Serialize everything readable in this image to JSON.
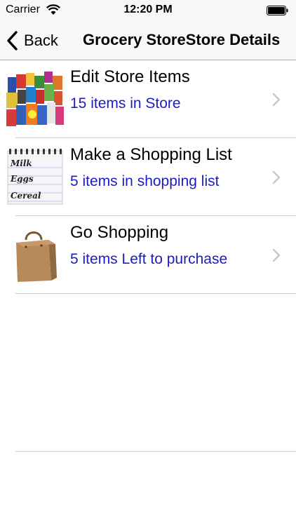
{
  "status_bar": {
    "carrier": "Carrier",
    "time": "12:20 PM",
    "wifi_icon": "wifi-icon",
    "battery_icon": "battery-icon"
  },
  "nav": {
    "back_label": "Back",
    "title": "Grocery StoreStore Details"
  },
  "rows": [
    {
      "title": "Edit Store Items",
      "subtitle": "15 items in Store",
      "icon": "grocery-products-icon"
    },
    {
      "title": "Make a Shopping List",
      "subtitle": "5 items in shopping list",
      "icon": "notepad-icon"
    },
    {
      "title": "Go Shopping",
      "subtitle": "5 items Left to purchase",
      "icon": "shopping-bag-icon"
    }
  ],
  "notepad_text": [
    "Milk",
    "Eggs",
    "Cereal"
  ],
  "colors": {
    "subtitle": "#1c1cc4",
    "nav_background": "#f7f7f7",
    "separator": "#d0d0d0"
  }
}
